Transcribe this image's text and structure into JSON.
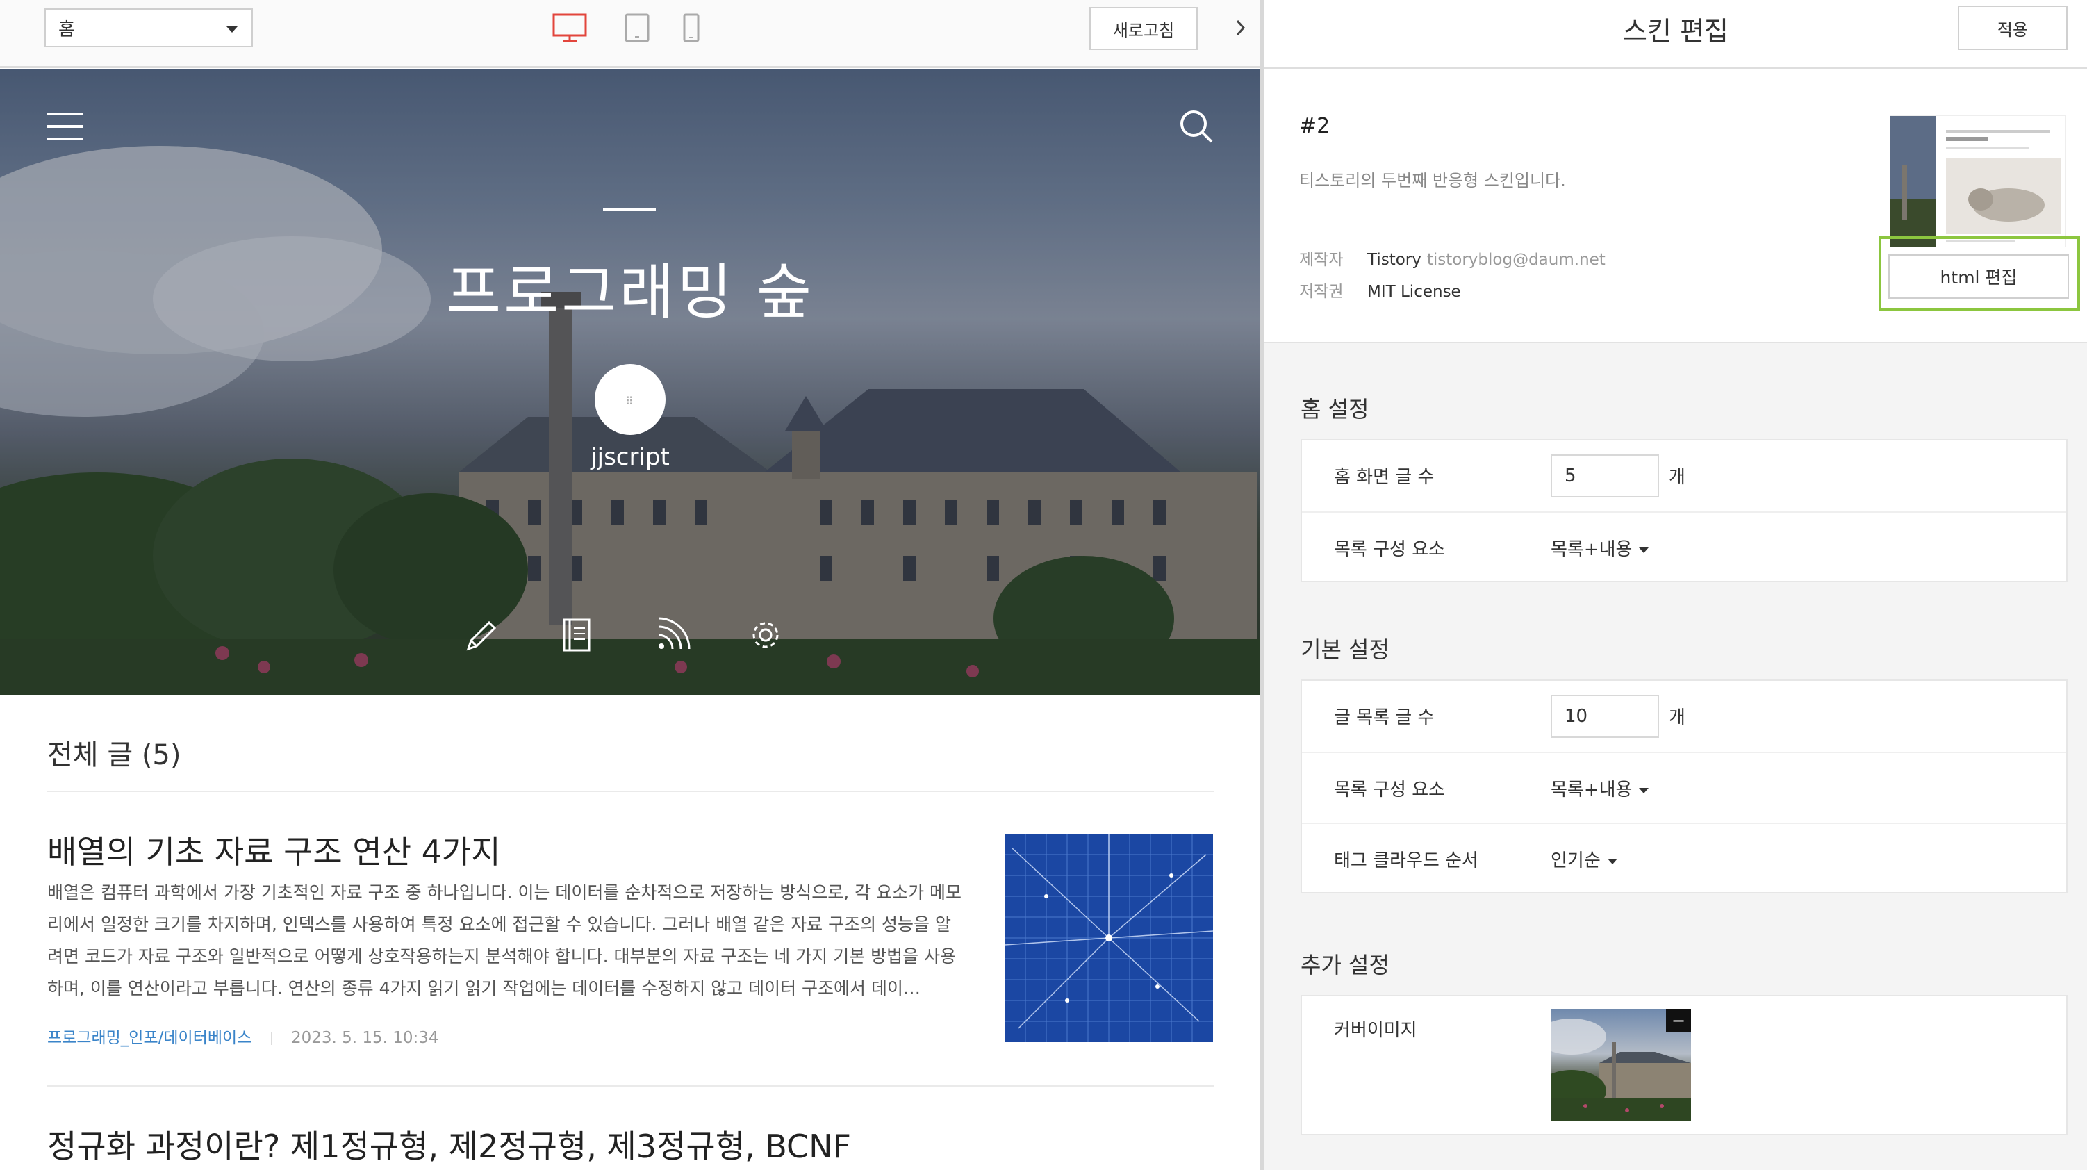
{
  "toolbar": {
    "page_select": "홈",
    "refresh_label": "새로고침"
  },
  "blog": {
    "title": "프로그래밍 숲",
    "username": "jjscript",
    "total_label": "전체 글 (5)",
    "posts": [
      {
        "title": "배열의 기초 자료 구조 연산 4가지",
        "excerpt": "배열은 컴퓨터 과학에서 가장 기초적인 자료 구조 중 하나입니다. 이는 데이터를 순차적으로 저장하는 방식으로, 각 요소가 메모리에서 일정한 크기를 차지하며, 인덱스를 사용하여 특정 요소에 접근할 수 있습니다. 그러나 배열 같은 자료 구조의 성능을 알려면 코드가 자료 구조와 일반적으로 어떻게 상호작용하는지 분석해야 합니다. 대부분의 자료 구조는 네 가지 기본 방법을 사용하며, 이를 연산이라고 부릅니다. 연산의 종류 4가지 읽기 읽기 작업에는 데이터를 수정하지 않고 데이터 구조에서 데이…",
        "category": "프로그래밍_인포/데이터베이스",
        "date": "2023. 5. 15. 10:34"
      },
      {
        "title": "정규화 과정이란? 제1정규형, 제2정규형, 제3정규형, BCNF"
      }
    ]
  },
  "panel": {
    "title": "스킨 편집",
    "apply_label": "적용",
    "skin": {
      "name": "#2",
      "description": "티스토리의 두번째 반응형 스킨입니다.",
      "author_key": "제작자",
      "author_name": "Tistory",
      "author_email": "tistoryblog@daum.net",
      "license_key": "저작권",
      "license_value": "MIT License",
      "html_edit_label": "html 편집"
    },
    "home_settings": {
      "title": "홈 설정",
      "post_count_label": "홈 화면 글 수",
      "post_count_value": "5",
      "unit": "개",
      "list_component_label": "목록 구성 요소",
      "list_component_value": "목록+내용"
    },
    "basic_settings": {
      "title": "기본 설정",
      "post_count_label": "글 목록 글 수",
      "post_count_value": "10",
      "unit": "개",
      "list_component_label": "목록 구성 요소",
      "list_component_value": "목록+내용",
      "tag_cloud_label": "태그 클라우드 순서",
      "tag_cloud_value": "인기순"
    },
    "extra_settings": {
      "title": "추가 설정",
      "cover_image_label": "커버이미지"
    }
  },
  "colors": {
    "accent_red": "#e2453c",
    "highlight_green": "#8cc63f",
    "category_blue": "#3a84c9"
  },
  "icons": [
    "chevron-down-icon",
    "desktop-icon",
    "tablet-icon",
    "mobile-icon",
    "chevron-right-icon",
    "hamburger-menu-icon",
    "search-icon",
    "pencil-icon",
    "book-icon",
    "rss-icon",
    "gear-icon",
    "minus-icon"
  ]
}
